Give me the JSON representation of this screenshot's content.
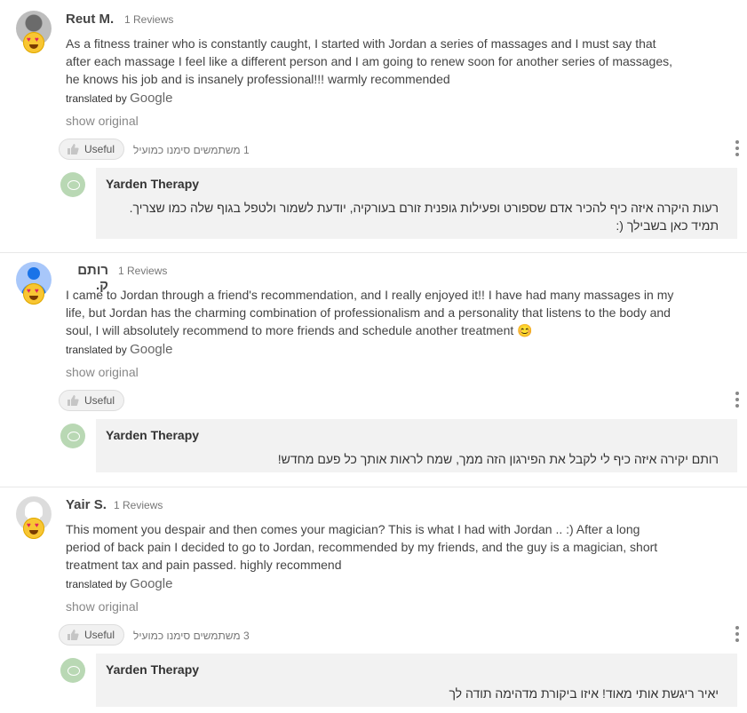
{
  "reviews": [
    {
      "name": "Reut M.",
      "count": "1 Reviews",
      "text": "As a fitness trainer who is constantly caught, I started with Jordan a series of massages and I must say that after each massage I feel like a different person and I am going to renew soon for another series of massages, he knows his job and is insanely professional!!! warmly recommended",
      "translated_by": "translated by",
      "google": "Google",
      "show_original": "show original",
      "useful_label": "Useful",
      "useful_count": "1 משתמשים סימנו כמועיל",
      "reply_name": "Yarden Therapy",
      "reply_text": "רעות היקרה איזה כיף להכיר אדם שספורט ופעילות גופנית זורם בעורקיה, יודעת לשמור ולטפל בגוף שלה כמו שצריך. תמיד כאן בשבילך (:"
    },
    {
      "name": "רותם ק.",
      "count": "1 Reviews",
      "text": "I came to Jordan through a friend's recommendation, and I really enjoyed it!! I have had many massages in my life, but Jordan has the charming combination of professionalism and a personality that listens to the body and soul, I will absolutely recommend to more friends and schedule another treatment 😊",
      "translated_by": "translated by",
      "google": "Google",
      "show_original": "show original",
      "useful_label": "Useful",
      "useful_count": "",
      "reply_name": "Yarden Therapy",
      "reply_text": "רותם יקירה איזה כיף לי לקבל את הפירגון הזה ממך, שמח לראות אותך כל פעם מחדש!"
    },
    {
      "name": "Yair S.",
      "count": "1 Reviews",
      "text": "This moment you despair and then comes your magician? This is what I had with Jordan .. :) After a long period of back pain I decided to go to Jordan, recommended by my friends, and the guy is a magician, short treatment tax and pain passed. highly recommend",
      "translated_by": "translated by",
      "google": "Google",
      "show_original": "show original",
      "useful_label": "Useful",
      "useful_count": "3 משתמשים סימנו כמועיל",
      "reply_name": "Yarden Therapy",
      "reply_text": "יאיר ריגשת אותי מאוד! איזו ביקורת מדהימה תודה לך"
    }
  ],
  "icons": {
    "emoji": "heart-eyes-emoji-icon",
    "thumb": "thumbs-up-icon",
    "more": "more-vertical-icon"
  },
  "colors": {
    "reply_bg": "#f2f2f2",
    "emoji": "#f8c633"
  }
}
